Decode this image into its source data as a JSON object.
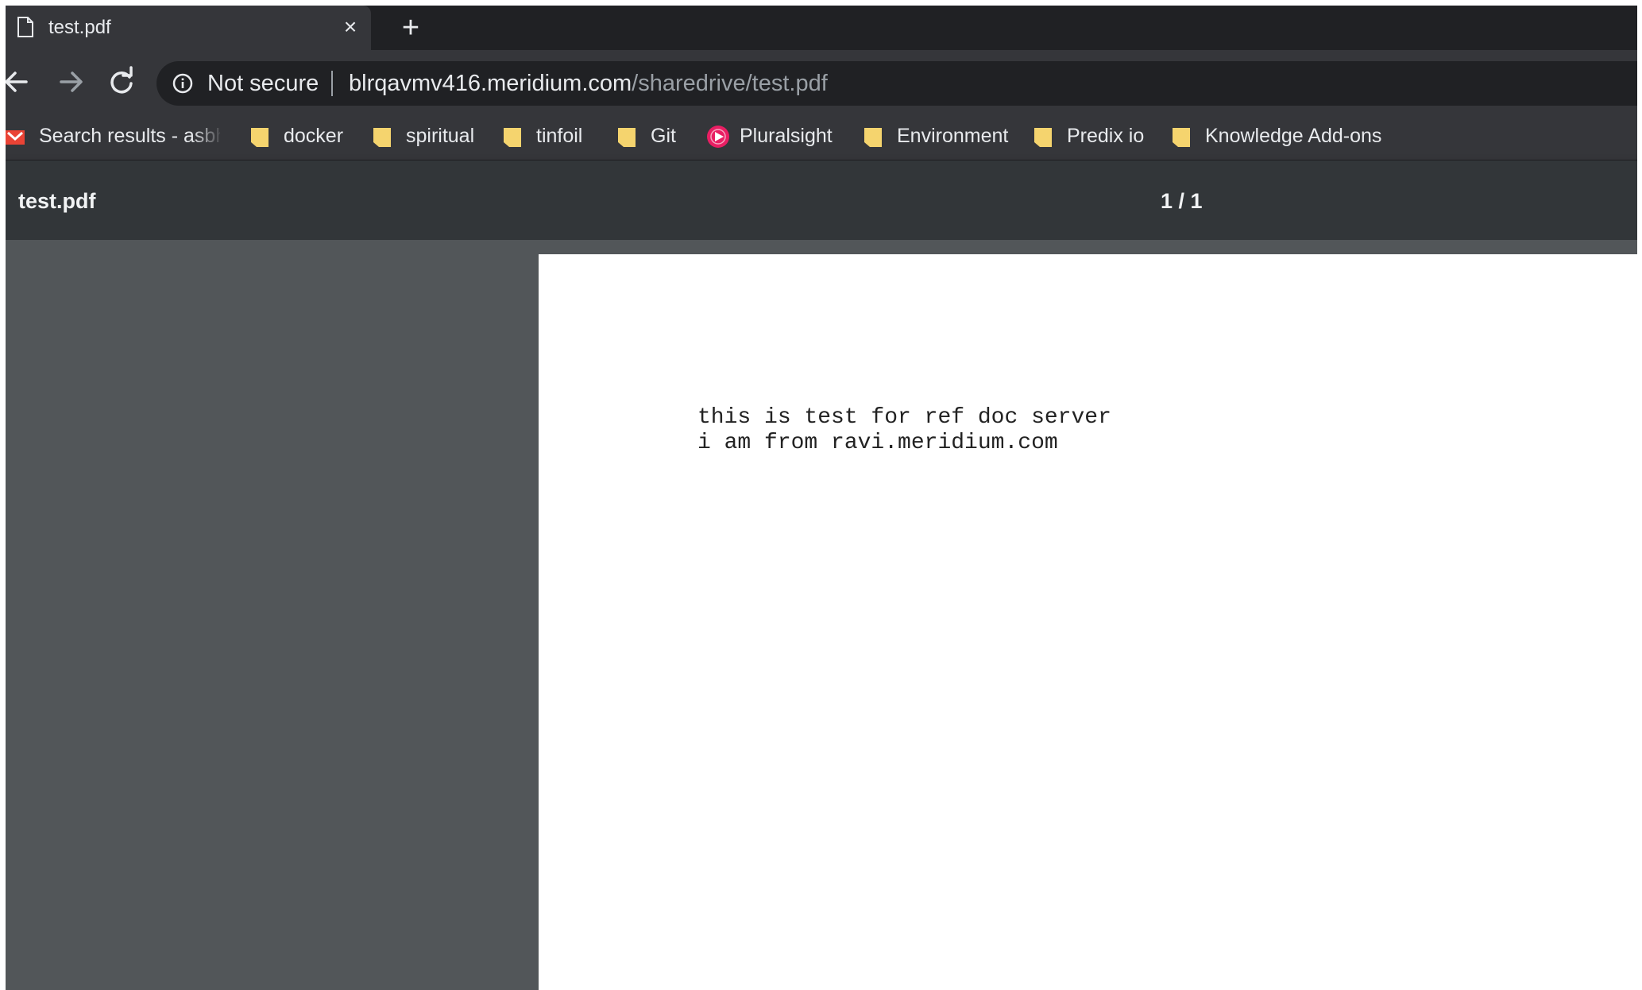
{
  "tab": {
    "title": "test.pdf",
    "close_glyph": "×",
    "new_tab_glyph": "+"
  },
  "toolbar": {
    "security_label": "Not secure",
    "url_host": "blrqavmv416.meridium.com",
    "url_path": "/sharedrive/test.pdf"
  },
  "bookmarks": [
    {
      "label": "Search results - asbhc",
      "icon": "gmail-icon"
    },
    {
      "label": "docker",
      "icon": "folder-icon"
    },
    {
      "label": "spiritual",
      "icon": "folder-icon"
    },
    {
      "label": "tinfoil",
      "icon": "folder-icon"
    },
    {
      "label": "Git",
      "icon": "folder-icon"
    },
    {
      "label": "Pluralsight",
      "icon": "pluralsight-icon"
    },
    {
      "label": "Environment",
      "icon": "folder-icon"
    },
    {
      "label": "Predix io",
      "icon": "folder-icon"
    },
    {
      "label": "Knowledge Add-ons",
      "icon": "folder-icon"
    }
  ],
  "pdf_viewer": {
    "title": "test.pdf",
    "page_counter": "1 / 1",
    "content_lines": [
      "this is test for ref doc server",
      "i am from ravi.meridium.com"
    ]
  },
  "colors": {
    "tab_strip": "#202124",
    "toolbar": "#35363a",
    "pdf_toolbar": "#323639",
    "pdf_canvas": "#525659",
    "folder": "#f5d46e",
    "gmail_red": "#ea4335",
    "pluralsight_pink": "#e91e63"
  }
}
